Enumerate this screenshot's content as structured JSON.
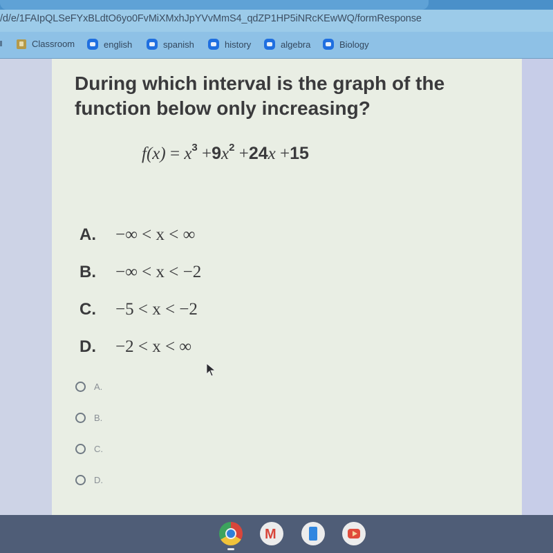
{
  "browser": {
    "url": "/d/e/1FAIpQLSeFYxBLdtO6yo0FvMiXMxhJpYVvMmS4_qdZP1HP5iNRcKEwWQ/formResponse",
    "bookmarks": [
      {
        "label": "Classroom",
        "icon": "classroom-icon"
      },
      {
        "label": "english",
        "icon": "zoom-meeting-icon"
      },
      {
        "label": "spanish",
        "icon": "zoom-meeting-icon"
      },
      {
        "label": "history",
        "icon": "zoom-meeting-icon"
      },
      {
        "label": "algebra",
        "icon": "zoom-meeting-icon"
      },
      {
        "label": "Biology",
        "icon": "zoom-meeting-icon"
      }
    ]
  },
  "question": {
    "text": "During which interval is the graph of the function below only increasing?",
    "formula": {
      "lhs": "f(x)",
      "eq": "=",
      "term1_base": "x",
      "term1_exp": "3",
      "plus1": "+",
      "term2_coef": "9",
      "term2_base": "x",
      "term2_exp": "2",
      "plus2": "+",
      "term3_coef": "24",
      "term3_base": "x",
      "plus3": "+",
      "constant": "15"
    },
    "choices": [
      {
        "letter": "A.",
        "expr": "−∞ < x < ∞"
      },
      {
        "letter": "B.",
        "expr": "−∞ < x < −2"
      },
      {
        "letter": "C.",
        "expr": "−5 < x < −2"
      },
      {
        "letter": "D.",
        "expr": "−2 < x < ∞"
      }
    ]
  },
  "answer_options": [
    {
      "label": "A.",
      "selected": false
    },
    {
      "label": "B.",
      "selected": false
    },
    {
      "label": "C.",
      "selected": false
    },
    {
      "label": "D.",
      "selected": false
    }
  ],
  "shelf": {
    "apps": [
      "chrome-icon",
      "gmail-icon",
      "docs-icon",
      "youtube-icon"
    ],
    "active_app": "chrome-icon"
  }
}
